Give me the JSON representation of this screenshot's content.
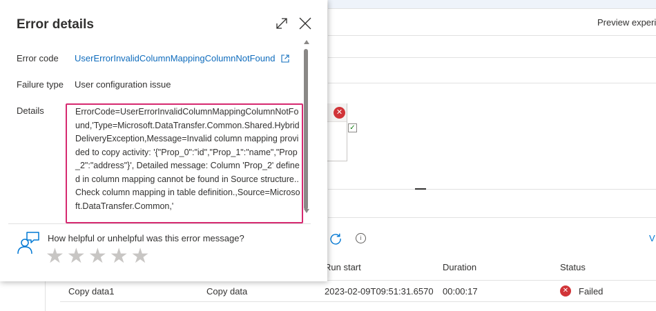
{
  "background": {
    "preview_label": "Preview experi",
    "edge_link": "V",
    "info_glyph": "i",
    "table": {
      "headers": {
        "run_start": "Run start",
        "duration": "Duration",
        "status": "Status"
      },
      "row": {
        "activity_name": "Copy data1",
        "activity_type": "Copy data",
        "run_start": "2023-02-09T09:51:31.6570",
        "duration": "00:00:17",
        "status": "Failed"
      }
    }
  },
  "panel": {
    "title": "Error details",
    "error_code_label": "Error code",
    "error_code_value": "UserErrorInvalidColumnMappingColumnNotFound",
    "failure_type_label": "Failure type",
    "failure_type_value": "User configuration issue",
    "details_label": "Details",
    "details_text": "ErrorCode=UserErrorInvalidColumnMappingColumnNotFound,'Type=Microsoft.DataTransfer.Common.Shared.HybridDeliveryException,Message=Invalid column mapping provided to copy activity: '{\"Prop_0\":\"id\",\"Prop_1\":\"name\",\"Prop_2\":\"address\"}', Detailed message: Column 'Prop_2' defined in column mapping cannot be found in Source structure.. Check column mapping in table definition.,Source=Microsoft.DataTransfer.Common,'",
    "feedback_question": "How helpful or unhelpful was this error message?",
    "star_count": 5,
    "star_glyph": "★"
  },
  "icons": {
    "expand": "expand-icon",
    "close": "close-icon",
    "external_link": "external-link-icon",
    "feedback": "feedback-person-icon",
    "refresh": "refresh-icon",
    "info": "info-icon",
    "failed": "error-circle-icon",
    "success": "checkmark-icon"
  },
  "colors": {
    "link": "#0f6cbd",
    "highlight_border": "#d6286f",
    "error_red": "#d13438",
    "success_green": "#107c10",
    "star_inactive": "#c8c6c4"
  }
}
